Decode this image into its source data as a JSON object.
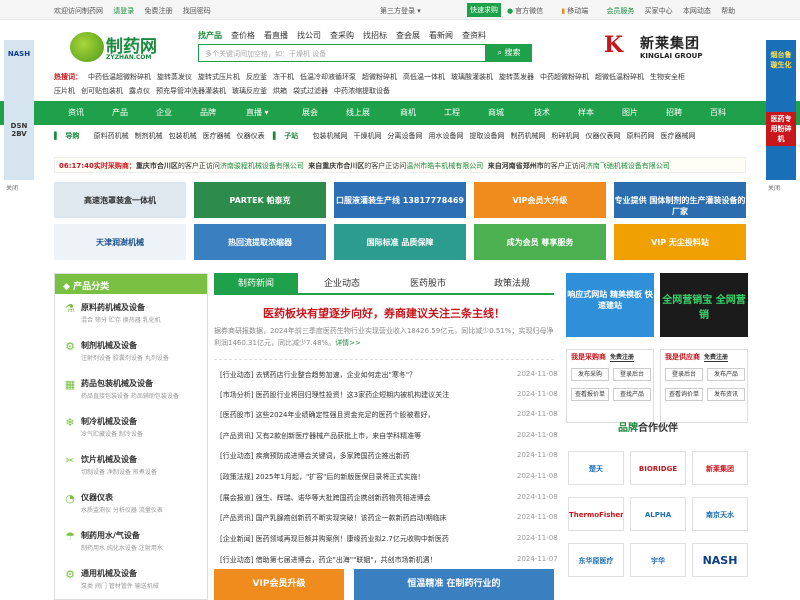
{
  "topbar": {
    "welcome": "欢迎访问制药网",
    "login": "请登录",
    "register": "免费注册",
    "forgot": "找回密码",
    "third_login": "第三方登录 ▾",
    "quick_buy": "快速求购",
    "wechat": "官方微信",
    "mobile": "移动端",
    "member": "会员服务",
    "buyer_center": "买家中心",
    "news_center": "本网动态",
    "help": "帮助"
  },
  "header": {
    "logo_cn": "制药网",
    "logo_en": "ZYZHAN.COM",
    "search_tabs": [
      "找产品",
      "查价格",
      "看直播",
      "找公司",
      "查采购",
      "找招标",
      "查会展",
      "看新闻",
      "查资料"
    ],
    "search_placeholder": "多个关键词间加空格，如：干燥机 设备",
    "search_button": "搜索",
    "ad_brand_cn": "新莱集团",
    "ad_brand_en": "KINGLAI GROUP",
    "ad_brand_mark": "K"
  },
  "hotsearch": {
    "label": "热搜词：",
    "line1": [
      "中药低温超微粉碎机",
      "旋转蒸发仪",
      "旋转式压片机",
      "反应釜",
      "冻干机",
      "低温冷却液循环泵",
      "超微粉碎机",
      "高低温一体机",
      "玻璃酸灌装机",
      "旋转蒸发器",
      "中药超微粉碎机",
      "超微低温粉碎机",
      "生物安全柜"
    ],
    "line2": [
      "压片机",
      "创可贴包装机",
      "露点仪",
      "预充导管冲洗器灌装机",
      "玻璃反应釜",
      "烘箱",
      "袋式过滤器",
      "中药浓缩提取设备"
    ]
  },
  "nav": {
    "items": [
      "资讯",
      "产品",
      "企业",
      "品牌",
      "直播 ▾",
      "展会",
      "线上展",
      "商机",
      "工程",
      "商城",
      "技术",
      "样本",
      "图片",
      "招聘",
      "百科"
    ]
  },
  "subnav": {
    "guide": "导购",
    "guide_items": [
      "原料药机械",
      "制剂机械",
      "包装机械",
      "医疗器械",
      "仪器仪表"
    ],
    "station": "子站",
    "station_items": [
      "包装机械网",
      "干燥机网",
      "分离设备网",
      "用水设备网",
      "提取设备网",
      "制药机械网",
      "粉碎机网",
      "仪器仪表网",
      "原料药网",
      "医疗器械网"
    ]
  },
  "scroll": {
    "time": "06:17:40",
    "label": "实时采购商：",
    "city1": "重庆市合川区",
    "mid1": "的客户正访问",
    "company1": "济南骏程机械设备有限公司",
    "city2": "来自重庆市合川区",
    "mid2": "的客户正访问",
    "company2": "温州市皓丰机械有限公司",
    "city3": "来自河南省郑州市",
    "mid3": "的客户正访问",
    "company3": "济南飞驰机械设备有限公司"
  },
  "banners": [
    {
      "text": "高速泡罩装盒一体机",
      "bg": "#dfe8ee",
      "fg": "#333"
    },
    {
      "text": "PARTEK 帕泰克",
      "bg": "#2d8c4b",
      "fg": "#fff"
    },
    {
      "text": "口服液灌装生产线 13817778469",
      "bg": "#2c6fb5",
      "fg": "#fff"
    },
    {
      "text": "VIP会员大升级",
      "bg": "#f08c1e",
      "fg": "#fff"
    },
    {
      "text": "专业提供 国体制剂的生产灌装设备的厂家",
      "bg": "#2b6eb0",
      "fg": "#fff"
    },
    {
      "text": "天津润澍机械",
      "bg": "#eef3f8",
      "fg": "#1c4f8c"
    },
    {
      "text": "热回流提取浓缩器",
      "bg": "#3a7fc0",
      "fg": "#fff"
    },
    {
      "text": "国际标准 品质保障",
      "bg": "#2c9c8e",
      "fg": "#fff"
    },
    {
      "text": "成为会员 尊享服务",
      "bg": "#4caf50",
      "fg": "#fff"
    },
    {
      "text": "VIP 无尘投料站",
      "bg": "#f0a000",
      "fg": "#fff"
    }
  ],
  "ads": {
    "left_brand": "NASH",
    "left_text": "DSN 2BV",
    "left_close": "关闭",
    "right_text1": "烟台鲁璇生化",
    "right_text2": "医药专用粉碎机",
    "right_close": "关闭"
  },
  "categories": {
    "title": "产品分类",
    "items": [
      {
        "name": "原料药机械及设备",
        "sub": "混合  筛分  贮存  换热器  乳化机"
      },
      {
        "name": "制剂机械及设备",
        "sub": "注射剂设备  胶囊剂设备  丸剂设备"
      },
      {
        "name": "药品包装机械及设备",
        "sub": "药品直接包装设备  药品辅助包装设备"
      },
      {
        "name": "制冷机械及设备",
        "sub": "冷气贮藏设备  制冷设备"
      },
      {
        "name": "饮片机械及设备",
        "sub": "切制设备  净制设备  煎煮设备"
      },
      {
        "name": "仪器仪表",
        "sub": "水质监测仪  分析仪器  流量仪表"
      },
      {
        "name": "制药用水/气设备",
        "sub": "制药用水  纯化水设备  注射用水"
      },
      {
        "name": "通用机械及设备",
        "sub": "泵类  阀门  管材管件  输送机械"
      }
    ]
  },
  "news": {
    "tabs": [
      "制药新闻",
      "企业动态",
      "医药股市",
      "政策法规"
    ],
    "headline": "医药板块有望逐步向好，券商建议关注三条主线！",
    "summary": "据券商研报数据，2024年前三季度医药生物行业实现营业收入18426.59亿元，同比减少0.51%；实现归母净利润1460.31亿元，同比减少7.48%。",
    "more": "详情>>",
    "items": [
      {
        "text": "[行业动态] 去锈药店行业整合趋势加速，企业如何走出\"寒冬\"？",
        "date": "2024-11-08"
      },
      {
        "text": "[市场分析] 医药股行业将回归理性投资！这3家药企短期内被机构建议关注",
        "date": "2024-11-08"
      },
      {
        "text": "[医药股市] 这些2024年业绩确定性强且资金充足的医药个股被看好，",
        "date": "2024-11-08"
      },
      {
        "text": "[产品资讯] 又有2款创新医疗器械产品获批上市，来自学科精准等",
        "date": "2024-11-08"
      },
      {
        "text": "[行业动态] 疾病预防成进博会关键词，多家跨国药企推出新药",
        "date": "2024-11-08"
      },
      {
        "text": "[政策法规] 2025年1月起，\"扩容\"后的新版医保目录将正式实施！",
        "date": "2024-11-08"
      },
      {
        "text": "[展会报道] 强生、辉瑞、诺华等大批跨国药企携创新药物亮相进博会",
        "date": "2024-11-08"
      },
      {
        "text": "[产品资讯] 国产乳腺癌创新药不断实现突破！该药企一款新药启动I期临床",
        "date": "2024-11-08"
      },
      {
        "text": "[企业新闻] 医药领域再现巨额并购案例！康缘药业拟2.7亿元收购中新医药",
        "date": "2024-11-08"
      },
      {
        "text": "[行业动态] 借助第七届进博会，药企\"出海\"\"联姻\"，共创市场新机遇！",
        "date": "2024-11-07"
      }
    ],
    "banner_left": "VIP会员升级",
    "banner_right": "恒温精准 在制药行业的"
  },
  "rightcol": {
    "img1": "响应式网站 精美模板 快速建站",
    "img2": "全网营销宝 全网营销",
    "svc_buy_title": "我是采购商",
    "svc_buy_reg": "免费注册",
    "svc_buy_btns": [
      "发布采购",
      "登录后台",
      "查看报价单",
      "查找产品"
    ],
    "svc_sell_title": "我是供应商",
    "svc_sell_reg": "免费注册",
    "svc_sell_btns": [
      "登录后台",
      "发布产品",
      "查看询价单",
      "发布资讯"
    ],
    "partner_prefix": "品牌",
    "partner_title": "合作伙伴",
    "partners": [
      {
        "name": "楚天",
        "color": "#1c6fb5"
      },
      {
        "name": "BIORIDGE",
        "color": "#c8161d"
      },
      {
        "name": "新莱集团",
        "color": "#c8161d"
      },
      {
        "name": "ThermoFisher",
        "color": "#c8161d"
      },
      {
        "name": "ALPHA",
        "color": "#1c6fb5"
      },
      {
        "name": "南京天水",
        "color": "#1c6fb5"
      },
      {
        "name": "东华原医疗",
        "color": "#1c6fb5"
      },
      {
        "name": "宇华",
        "color": "#1c6fb5"
      },
      {
        "name": "NASH",
        "color": "#0c3d8a"
      }
    ]
  }
}
